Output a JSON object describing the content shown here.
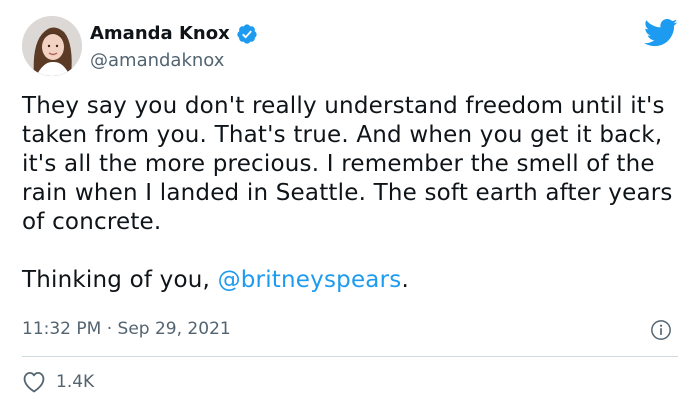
{
  "author": {
    "display_name": "Amanda Knox",
    "handle": "@amandaknox",
    "verified": true
  },
  "tweet": {
    "paragraph_1": "They say you don't really understand freedom until it's taken from you. That's true. And when you get it back, it's all the more precious. I remember the smell of the rain when I landed in Seattle. The soft earth after years of concrete.",
    "paragraph_2_prefix": "Thinking of you, ",
    "mention": "@britneyspears",
    "paragraph_2_suffix": ".",
    "time": "11:32 PM",
    "separator": " · ",
    "date": "Sep 29, 2021"
  },
  "stats": {
    "likes": "1.4K"
  },
  "icons": {
    "verified": "verified-badge-icon",
    "brand": "twitter-bird-icon",
    "info": "info-icon",
    "like": "heart-icon"
  },
  "colors": {
    "accent": "#1d9bf0",
    "text": "#0f1419",
    "secondary": "#536471",
    "divider": "#cfd9de"
  }
}
